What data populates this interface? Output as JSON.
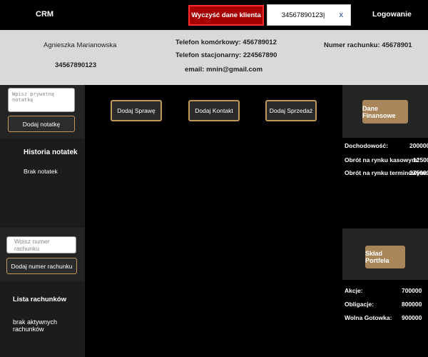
{
  "header": {
    "brand": "CRM",
    "clear_button": "Wyczyść dane klienta",
    "search_value": "34567890123|",
    "search_clear": "x",
    "login": "Logowanie"
  },
  "client": {
    "name": "Agnieszka Marianowska",
    "id": "34567890123",
    "mobile": "Telefon komórkowy: 456789012",
    "landline": "Telefon stacjonarny: 224567890",
    "email": "email: mnin@gmail.com",
    "account": "Numer rachunku: 45678901"
  },
  "notes": {
    "placeholder": "Wpisz prywatną notatkę",
    "add_button": "Dodaj notatkę",
    "history_title": "Historia notatek",
    "history_empty": "Brak notatek"
  },
  "accounts": {
    "placeholder": "Wpisz numer rachunku",
    "add_button": "Dodaj numer rachunku",
    "list_title": "Lista rachunków",
    "list_empty": "brak aktywnych rachunków"
  },
  "actions": {
    "add_case": "Dodaj Sprawę",
    "add_contact": "Dodaj Kontakt",
    "add_sale": "Dodaj Sprzedaż"
  },
  "finance": {
    "button": "Dane Finansowe",
    "rows": [
      {
        "label": "Dochodowość:",
        "value": "200000"
      },
      {
        "label": "Obrót na rynku kasowym:",
        "value": "125000"
      },
      {
        "label": "Obrót na rynku terminowym:",
        "value": "275000"
      }
    ]
  },
  "portfolio": {
    "button": "Skład Portfela",
    "rows": [
      {
        "label": "Akcje:",
        "value": "700000"
      },
      {
        "label": "Obligacje:",
        "value": "800000"
      },
      {
        "label": "Wolna Gotowka:",
        "value": "900000"
      }
    ]
  }
}
